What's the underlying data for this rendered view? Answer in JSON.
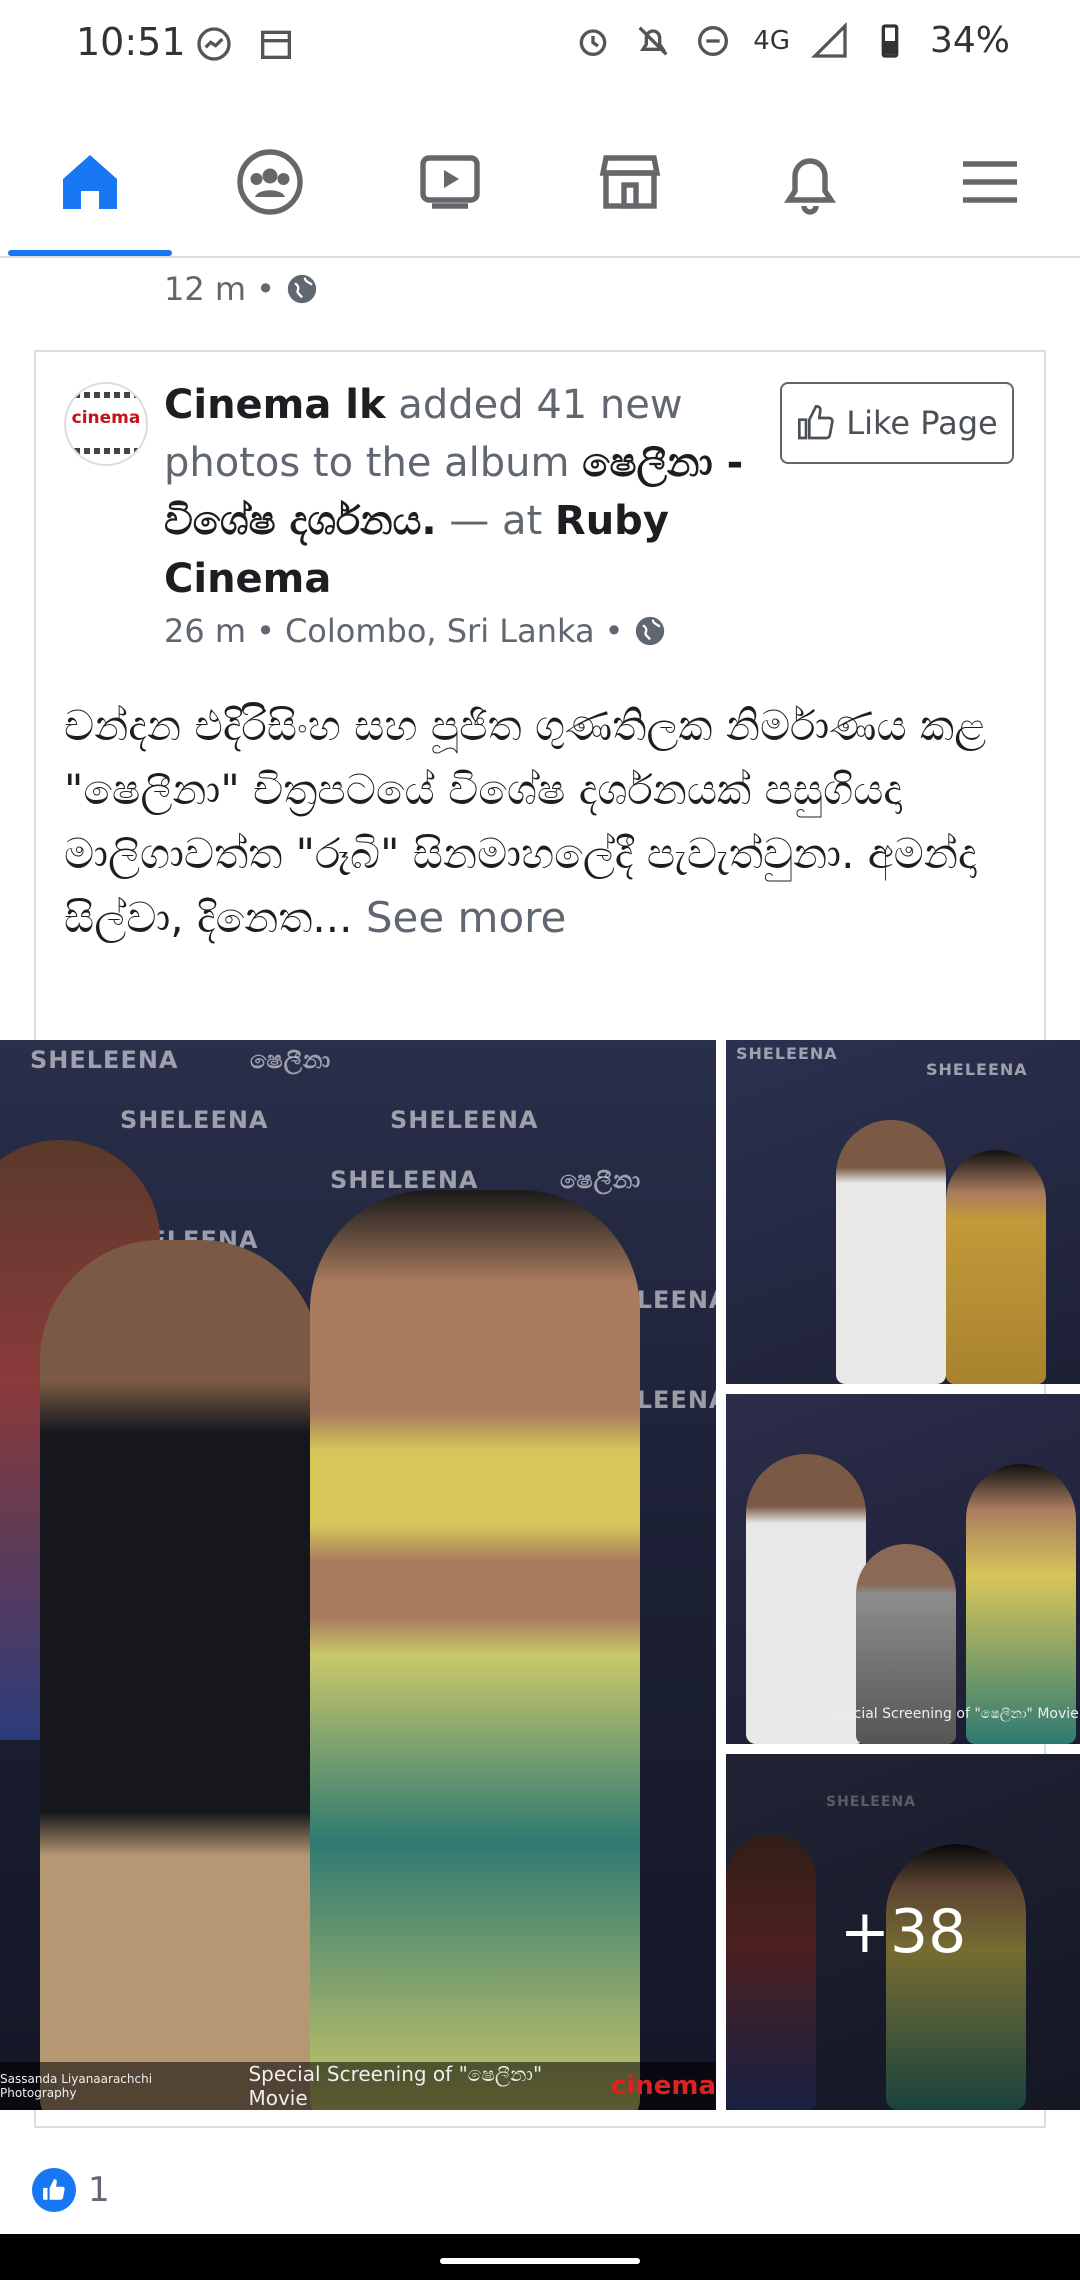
{
  "status_bar": {
    "time": "10:51",
    "network": "4G",
    "battery": "34%",
    "icons": [
      "messenger-icon",
      "calendar-icon",
      "alarm-icon",
      "notifications-off-icon",
      "do-not-disturb-icon",
      "signal-icon",
      "battery-icon"
    ]
  },
  "tabs": [
    {
      "name": "home",
      "icon": "home-icon",
      "active": true
    },
    {
      "name": "groups",
      "icon": "groups-icon",
      "active": false
    },
    {
      "name": "watch",
      "icon": "video-icon",
      "active": false
    },
    {
      "name": "marketplace",
      "icon": "marketplace-icon",
      "active": false
    },
    {
      "name": "notifications",
      "icon": "bell-icon",
      "active": false
    },
    {
      "name": "menu",
      "icon": "hamburger-icon",
      "active": false
    }
  ],
  "previous_post": {
    "time": "12 m",
    "privacy_icon": "globe-icon"
  },
  "post": {
    "page_name": "Cinema lk",
    "action_text": " added 41 new photos to the album ",
    "album": "ෂෙලීනා - විශේෂ දර්ශනය.",
    "at_text": " — at ",
    "place": "Ruby Cinema",
    "time": "26 m",
    "location": "Colombo, Sri Lanka",
    "like_page_label": "Like Page",
    "avatar_logo": "cinema",
    "body": "චන්දන එදිරිසිංහ සහ පූජිත ගුණතිලක නිර්මාණය කළ \"ෂෙලීනා\" චිත්‍රපටයේ විශේෂ දර්ශනයක් පසුගියදා මාලිගාවත්ත \"රූබි\" සිනමාහලේදී පැවැත්වුනා. අමන්දා සිල්වා, දිනෙත...",
    "see_more": " See more",
    "photos": {
      "backdrop_word": "SHELEENA",
      "backdrop_word_si": "ෂෙලීනා",
      "main_caption": "Special Screening of \"ෂෙලීනා\" Movie",
      "main_credit": "Sassanda Liyanaarachchi Photography",
      "main_logo": "cinema",
      "side_caption": "Special Screening of \"ෂෙලීනා\" Movie",
      "more_count": "+38"
    },
    "reaction_count": "1"
  },
  "colors": {
    "accent": "#1877f2",
    "text": "#1c1e21",
    "secondary": "#606770"
  }
}
